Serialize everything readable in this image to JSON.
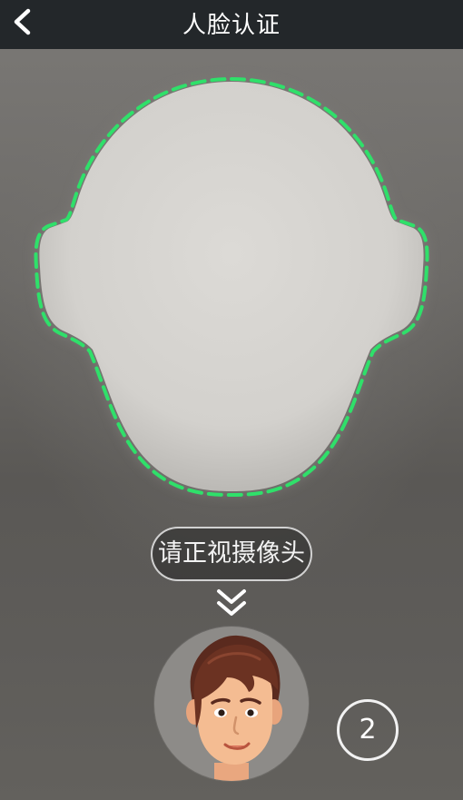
{
  "header": {
    "title": "人脸认证",
    "back_icon": "back-arrow-icon"
  },
  "camera": {
    "face_outline_color": "#2fe06a",
    "hint_text": "请正视摄像头",
    "arrow_icon": "double-chevron-down-icon",
    "avatar_icon": "cartoon-face-avatar",
    "countdown": "2"
  }
}
